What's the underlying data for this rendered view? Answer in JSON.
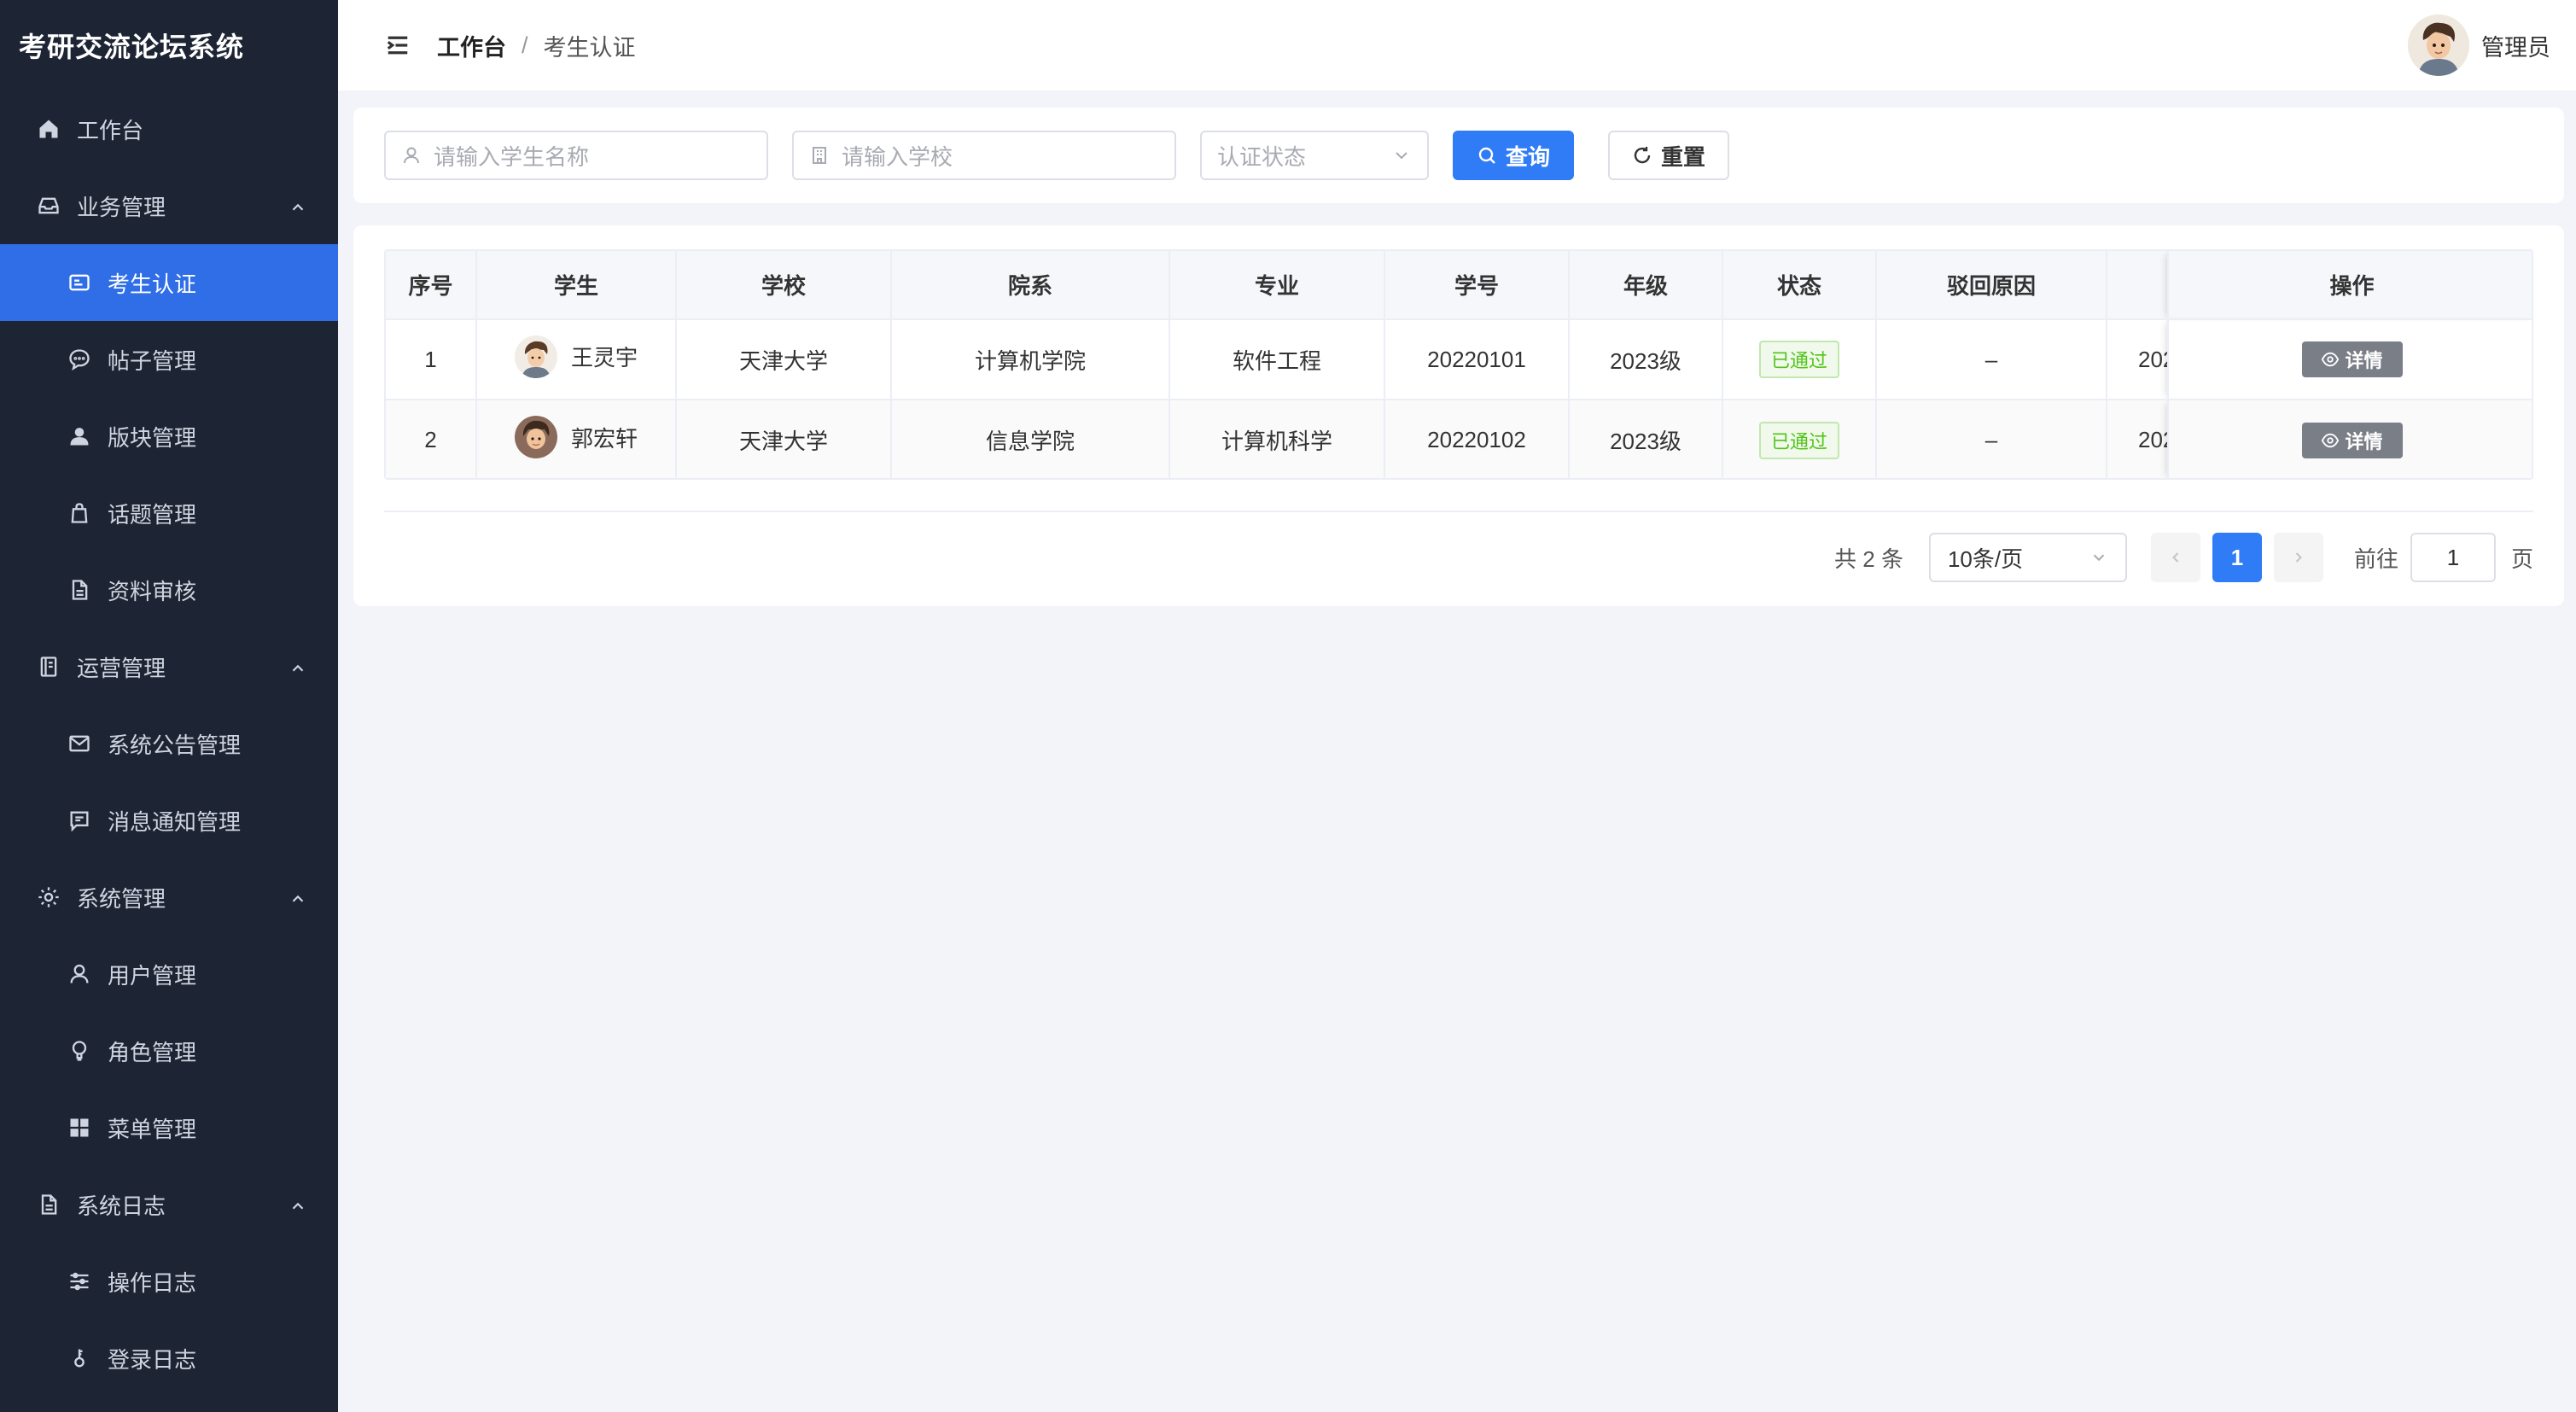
{
  "sidebar": {
    "brand": "考研交流论坛系统",
    "items": [
      {
        "label": "工作台"
      },
      {
        "label": "业务管理"
      },
      {
        "label": "考生认证"
      },
      {
        "label": "帖子管理"
      },
      {
        "label": "版块管理"
      },
      {
        "label": "话题管理"
      },
      {
        "label": "资料审核"
      },
      {
        "label": "运营管理"
      },
      {
        "label": "系统公告管理"
      },
      {
        "label": "消息通知管理"
      },
      {
        "label": "系统管理"
      },
      {
        "label": "用户管理"
      },
      {
        "label": "角色管理"
      },
      {
        "label": "菜单管理"
      },
      {
        "label": "系统日志"
      },
      {
        "label": "操作日志"
      },
      {
        "label": "登录日志"
      }
    ]
  },
  "header": {
    "breadcrumb_home": "工作台",
    "breadcrumb_sep": "/",
    "breadcrumb_current": "考生认证",
    "user_name": "管理员"
  },
  "search": {
    "student_placeholder": "请输入学生名称",
    "school_placeholder": "请输入学校",
    "status_placeholder": "认证状态",
    "query_label": "查询",
    "reset_label": "重置"
  },
  "table": {
    "columns": [
      "序号",
      "学生",
      "学校",
      "院系",
      "专业",
      "学号",
      "年级",
      "状态",
      "驳回原因",
      "操作"
    ],
    "rows": [
      {
        "index": "1",
        "student": "王灵宇",
        "school": "天津大学",
        "dept": "计算机学院",
        "major": "软件工程",
        "sid": "20220101",
        "grade": "2023级",
        "status": "已通过",
        "reason": "–",
        "truncated": "202",
        "action": "详情"
      },
      {
        "index": "2",
        "student": "郭宏轩",
        "school": "天津大学",
        "dept": "信息学院",
        "major": "计算机科学",
        "sid": "20220102",
        "grade": "2023级",
        "status": "已通过",
        "reason": "–",
        "truncated": "202",
        "action": "详情"
      }
    ]
  },
  "pagination": {
    "total_text": "共 2 条",
    "page_size": "10条/页",
    "current_page": "1",
    "goto_label": "前往",
    "goto_value": "1",
    "page_suffix": "页"
  },
  "colors": {
    "sidebar_bg": "#1d2433",
    "active_menu": "#2f6ee6",
    "primary": "#2f7cf6",
    "success": "#52c41a"
  }
}
